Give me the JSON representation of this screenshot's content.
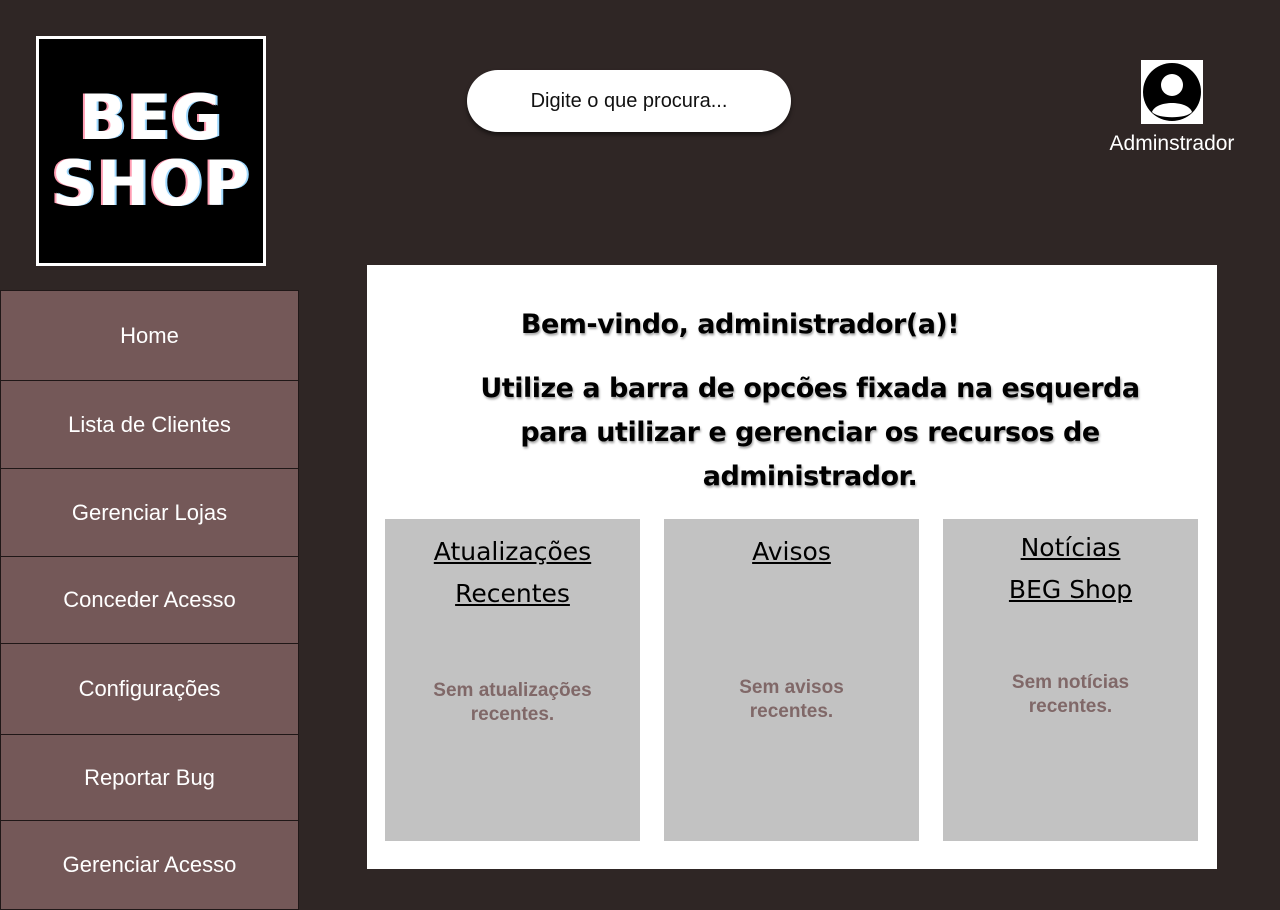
{
  "logo": {
    "line1": "BEG",
    "line2": "SHOP"
  },
  "search": {
    "placeholder": "Digite o que procura..."
  },
  "user": {
    "name": "Adminstrador",
    "icon": "user-avatar-icon"
  },
  "sidebar": {
    "items": [
      {
        "label": "Home"
      },
      {
        "label": "Lista de Clientes"
      },
      {
        "label": "Gerenciar Lojas"
      },
      {
        "label": "Conceder Acesso"
      },
      {
        "label": "Configurações"
      },
      {
        "label": "Reportar Bug"
      },
      {
        "label": "Gerenciar Acesso"
      }
    ]
  },
  "main": {
    "welcome": "Bem-vindo, administrador(a)!",
    "instructions": "Utilize a barra de opcões fixada na esquerda para utilizar e gerenciar os recursos de administrador.",
    "cards": [
      {
        "title": "Atualizações\nRecentes",
        "body": "Sem atualizações\nrecentes."
      },
      {
        "title": "Avisos",
        "body": "Sem avisos\nrecentes."
      },
      {
        "title": "Notícias \nBEG Shop",
        "body": "Sem notícias\nrecentes."
      }
    ]
  },
  "colors": {
    "background": "#2f2625",
    "sidebar": "#745858",
    "card": "#c2c2c2",
    "card_text": "#806868"
  }
}
